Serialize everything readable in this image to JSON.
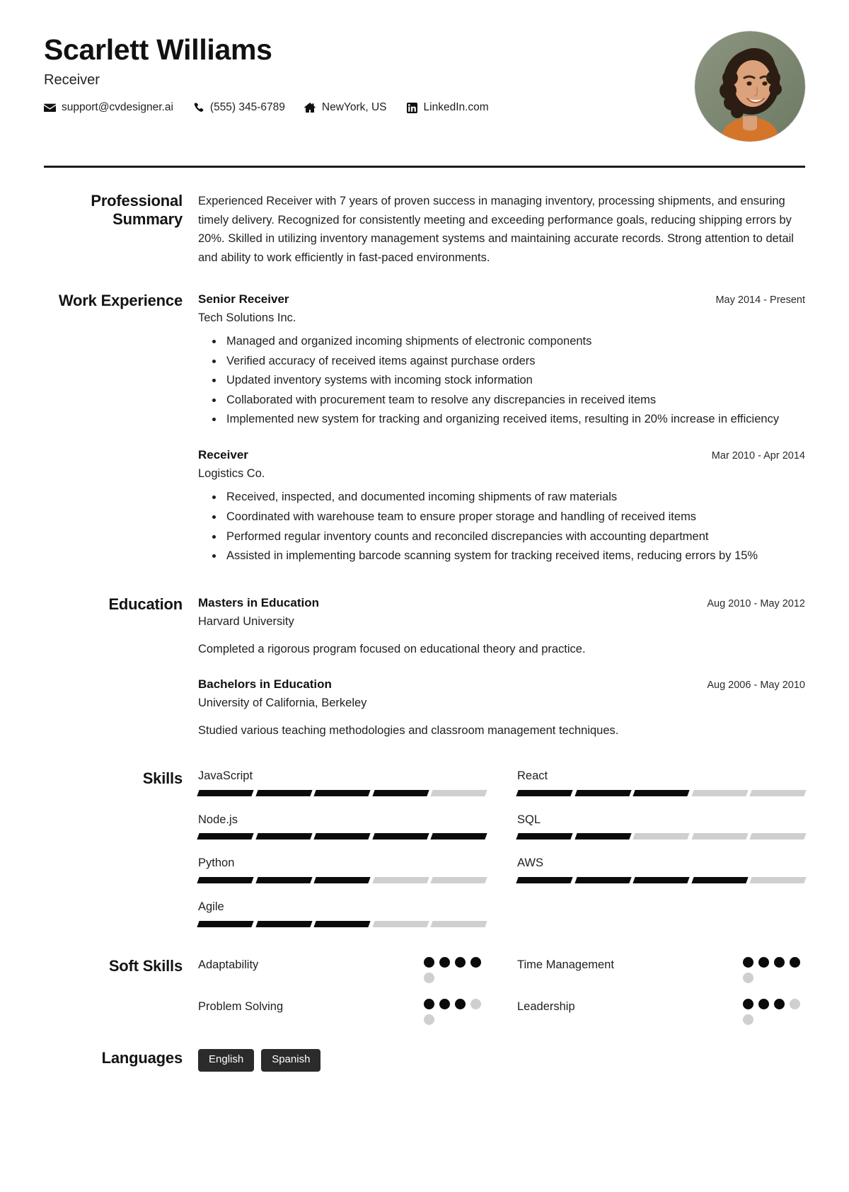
{
  "header": {
    "name": "Scarlett Williams",
    "title": "Receiver",
    "contacts": [
      {
        "icon": "email-icon",
        "text": "support@cvdesigner.ai"
      },
      {
        "icon": "phone-icon",
        "text": "(555) 345-6789"
      },
      {
        "icon": "home-icon",
        "text": "NewYork, US"
      },
      {
        "icon": "linkedin-icon",
        "text": "LinkedIn.com"
      }
    ],
    "avatar": {
      "alt": "profile-photo",
      "background_color": "#7e8a72",
      "skin_color": "#d9a079",
      "hair_color": "#2f2017",
      "shirt_color": "#d4752a"
    }
  },
  "sections": {
    "summary": {
      "label": "Professional Summary",
      "text": "Experienced Receiver with 7 years of proven success in managing inventory, processing shipments, and ensuring timely delivery. Recognized for consistently meeting and exceeding performance goals, reducing shipping errors by 20%. Skilled in utilizing inventory management systems and maintaining accurate records. Strong attention to detail and ability to work efficiently in fast-paced environments."
    },
    "work": {
      "label": "Work Experience",
      "entries": [
        {
          "title": "Senior Receiver",
          "organization": "Tech Solutions Inc.",
          "date": "May 2014 - Present",
          "bullets": [
            "Managed and organized incoming shipments of electronic components",
            "Verified accuracy of received items against purchase orders",
            "Updated inventory systems with incoming stock information",
            "Collaborated with procurement team to resolve any discrepancies in received items",
            "Implemented new system for tracking and organizing received items, resulting in 20% increase in efficiency"
          ]
        },
        {
          "title": "Receiver",
          "organization": "Logistics Co.",
          "date": "Mar 2010 - Apr 2014",
          "bullets": [
            "Received, inspected, and documented incoming shipments of raw materials",
            "Coordinated with warehouse team to ensure proper storage and handling of received items",
            "Performed regular inventory counts and reconciled discrepancies with accounting department",
            "Assisted in implementing barcode scanning system for tracking received items, reducing errors by 15%"
          ]
        }
      ]
    },
    "education": {
      "label": "Education",
      "entries": [
        {
          "title": "Masters in Education",
          "organization": "Harvard University",
          "date": "Aug 2010 - May 2012",
          "description": "Completed a rigorous program focused on educational theory and practice."
        },
        {
          "title": "Bachelors in Education",
          "organization": "University of California, Berkeley",
          "date": "Aug 2006 - May 2010",
          "description": "Studied various teaching methodologies and classroom management techniques."
        }
      ]
    },
    "skills": {
      "label": "Skills",
      "max_level": 5,
      "items": [
        {
          "name": "JavaScript",
          "level": 4
        },
        {
          "name": "React",
          "level": 3
        },
        {
          "name": "Node.js",
          "level": 5
        },
        {
          "name": "SQL",
          "level": 2
        },
        {
          "name": "Python",
          "level": 3
        },
        {
          "name": "AWS",
          "level": 4
        },
        {
          "name": "Agile",
          "level": 3
        }
      ]
    },
    "soft_skills": {
      "label": "Soft Skills",
      "max_level": 5,
      "items": [
        {
          "name": "Adaptability",
          "level": 4
        },
        {
          "name": "Time Management",
          "level": 4
        },
        {
          "name": "Problem Solving",
          "level": 3
        },
        {
          "name": "Leadership",
          "level": 3
        }
      ]
    },
    "languages": {
      "label": "Languages",
      "items": [
        "English",
        "Spanish"
      ]
    }
  },
  "colors": {
    "text": "#1f1f1f",
    "heading": "#111111",
    "rule": "#1b1b1b",
    "bar_on": "#0b0b0b",
    "bar_off": "#cfcfcf",
    "chip_bg": "#2b2b2b",
    "chip_text": "#ffffff"
  }
}
